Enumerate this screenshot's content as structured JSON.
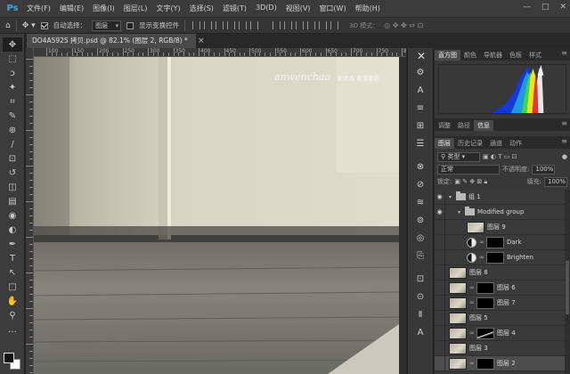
{
  "menubar": {
    "logo": "Ps",
    "items": [
      "文件(F)",
      "编辑(E)",
      "图像(I)",
      "图层(L)",
      "文字(Y)",
      "选择(S)",
      "滤镜(T)",
      "3D(D)",
      "视图(V)",
      "窗口(W)",
      "帮助(H)"
    ],
    "controls": [
      "—",
      "□",
      "✕"
    ]
  },
  "options": {
    "auto_select_label": "自动选择：",
    "auto_select_value": "图层",
    "show_transform_label": "显示变换控件",
    "mode_3d_label": "3D 模式："
  },
  "document": {
    "tab_title": "DO4A5925 拷贝.psd @ 82.1% (图层 2, RGB/8) *",
    "tab_close": "×",
    "ruler_labels": [
      "100",
      "150",
      "200",
      "250",
      "300",
      "350",
      "400",
      "450",
      "500",
      "550",
      "600",
      "650",
      "700",
      "750",
      "800"
    ],
    "watermark_title": "anwenchao",
    "watermark_sub": "安文昌 高清摄影"
  },
  "panels": {
    "top_tabs": [
      "直方图",
      "颜色",
      "导航器",
      "色板",
      "样式"
    ],
    "mid_tabs": [
      "调整",
      "路径",
      "信息"
    ],
    "layer_tabs": [
      "图层",
      "历史记录",
      "通道",
      "动作"
    ],
    "filter_kind": "类型",
    "blend_mode": "正常",
    "opacity_label": "不透明度:",
    "opacity_value": "100%",
    "lock_label": "锁定:",
    "fill_label": "填充:",
    "fill_value": "100%"
  },
  "layers": [
    {
      "name": "组 1",
      "kind": "group",
      "visible": true,
      "indent": 0
    },
    {
      "name": "Modified group",
      "kind": "group",
      "visible": true,
      "indent": 1
    },
    {
      "name": "图层 9",
      "kind": "pixel",
      "visible": false,
      "indent": 2
    },
    {
      "name": "Dark",
      "kind": "adjust",
      "visible": false,
      "indent": 2
    },
    {
      "name": "Brighten",
      "kind": "adjust",
      "visible": false,
      "indent": 2
    },
    {
      "name": "图层 8",
      "kind": "pixel",
      "visible": false,
      "indent": 0
    },
    {
      "name": "图层 6",
      "kind": "masked",
      "visible": false,
      "indent": 0
    },
    {
      "name": "图层 7",
      "kind": "masked",
      "visible": false,
      "indent": 0
    },
    {
      "name": "图层 5",
      "kind": "pixel",
      "visible": false,
      "indent": 0
    },
    {
      "name": "图层 4",
      "kind": "masked-shape",
      "visible": false,
      "indent": 0
    },
    {
      "name": "图层 3",
      "kind": "pixel",
      "visible": false,
      "indent": 0
    },
    {
      "name": "图层 2",
      "kind": "masked",
      "visible": false,
      "indent": 0,
      "selected": true
    }
  ],
  "tools": [
    "move",
    "marquee",
    "lasso",
    "magic-wand",
    "crop",
    "eyedropper",
    "healing",
    "brush",
    "stamp",
    "history-brush",
    "eraser",
    "gradient",
    "blur",
    "dodge",
    "pen",
    "type",
    "path-select",
    "shape",
    "hand",
    "zoom",
    "more"
  ],
  "tool_glyphs": [
    "✥",
    "⬚",
    "ↄ",
    "✦",
    "⌗",
    "✎",
    "⊕",
    "∕",
    "⊡",
    "↺",
    "◫",
    "▤",
    "◉",
    "◐",
    "✒",
    "T",
    "↖",
    "□",
    "✋",
    "⚲",
    "…"
  ],
  "dock_icons": [
    "✕",
    "⚙",
    "A",
    "≡",
    "⊞",
    "☰",
    "⊗",
    "⊘",
    "≋",
    "⊚",
    "◎",
    "⎘",
    "⊡",
    "⊙",
    "Ⅱ",
    "A"
  ],
  "dock_icon_names": [
    "close-dock",
    "tool-presets",
    "character",
    "paragraph",
    "properties",
    "libraries",
    "adjust-a",
    "adjust-b",
    "adjust-c",
    "3d",
    "timeline",
    "clone-source",
    "brush",
    "glyphs",
    "history",
    "type-tool"
  ],
  "colors": {
    "accent": "#3aa5e6",
    "panel": "#383838",
    "canvas_wall": "#d6d4c2"
  }
}
